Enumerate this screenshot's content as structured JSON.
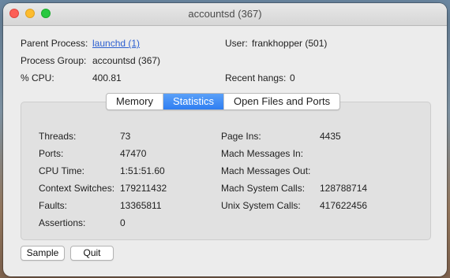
{
  "window": {
    "title": "accountsd (367)"
  },
  "info": {
    "parent_process_label": "Parent Process:",
    "parent_process_value": "launchd (1)",
    "user_label": "User:",
    "user_value": "frankhopper (501)",
    "process_group_label": "Process Group:",
    "process_group_value": "accountsd (367)",
    "cpu_label": "% CPU:",
    "cpu_value": "400.81",
    "recent_hangs_label": "Recent hangs:",
    "recent_hangs_value": "0"
  },
  "tabs": [
    {
      "label": "Memory"
    },
    {
      "label": "Statistics",
      "selected": true
    },
    {
      "label": "Open Files and Ports"
    }
  ],
  "stats": {
    "left": [
      {
        "label": "Threads:",
        "value": "73"
      },
      {
        "label": "Ports:",
        "value": "47470"
      },
      {
        "label": "CPU Time:",
        "value": "1:51:51.60"
      },
      {
        "label": "Context Switches:",
        "value": "179211432"
      },
      {
        "label": "Faults:",
        "value": "13365811"
      },
      {
        "label": "Assertions:",
        "value": "0"
      }
    ],
    "right": [
      {
        "label": "Page Ins:",
        "value": "4435"
      },
      {
        "label": "Mach Messages In:",
        "value": ""
      },
      {
        "label": "Mach Messages Out:",
        "value": ""
      },
      {
        "label": "Mach System Calls:",
        "value": "128788714"
      },
      {
        "label": "Unix System Calls:",
        "value": "417622456"
      }
    ]
  },
  "buttons": {
    "sample": "Sample",
    "quit": "Quit"
  },
  "colors": {
    "accent": "#2f7ef2",
    "link": "#2b5fd0",
    "window_bg": "#ececec"
  }
}
